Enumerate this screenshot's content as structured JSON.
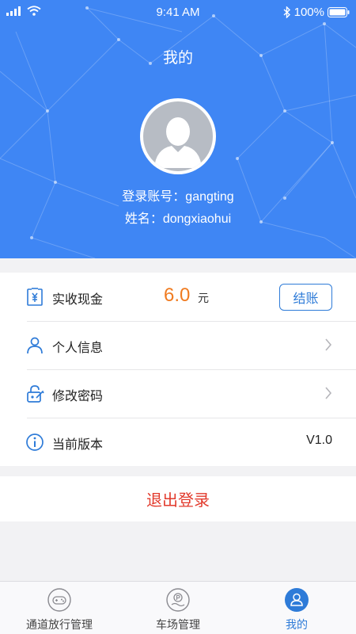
{
  "status_bar": {
    "time": "9:41 AM",
    "battery": "100%"
  },
  "header": {
    "title": "我的",
    "account_line": "登录账号：gangting",
    "name_line": "姓名：dongxiaohui"
  },
  "cash": {
    "label": "实收现金",
    "amount": "6.0",
    "unit": "元",
    "button": "结账"
  },
  "menu": {
    "personal_info": "个人信息",
    "change_password": "修改密码",
    "version_label": "当前版本",
    "version_value": "V1.0"
  },
  "logout": "退出登录",
  "tabs": [
    {
      "label": "通道放行管理",
      "icon": "gamepad-icon"
    },
    {
      "label": "车场管理",
      "icon": "parking-icon"
    },
    {
      "label": "我的",
      "icon": "user-icon"
    }
  ],
  "colors": {
    "primary": "#3f86f4",
    "accent": "#2e7bd8",
    "amount": "#f07b20",
    "danger": "#e23a2c"
  }
}
